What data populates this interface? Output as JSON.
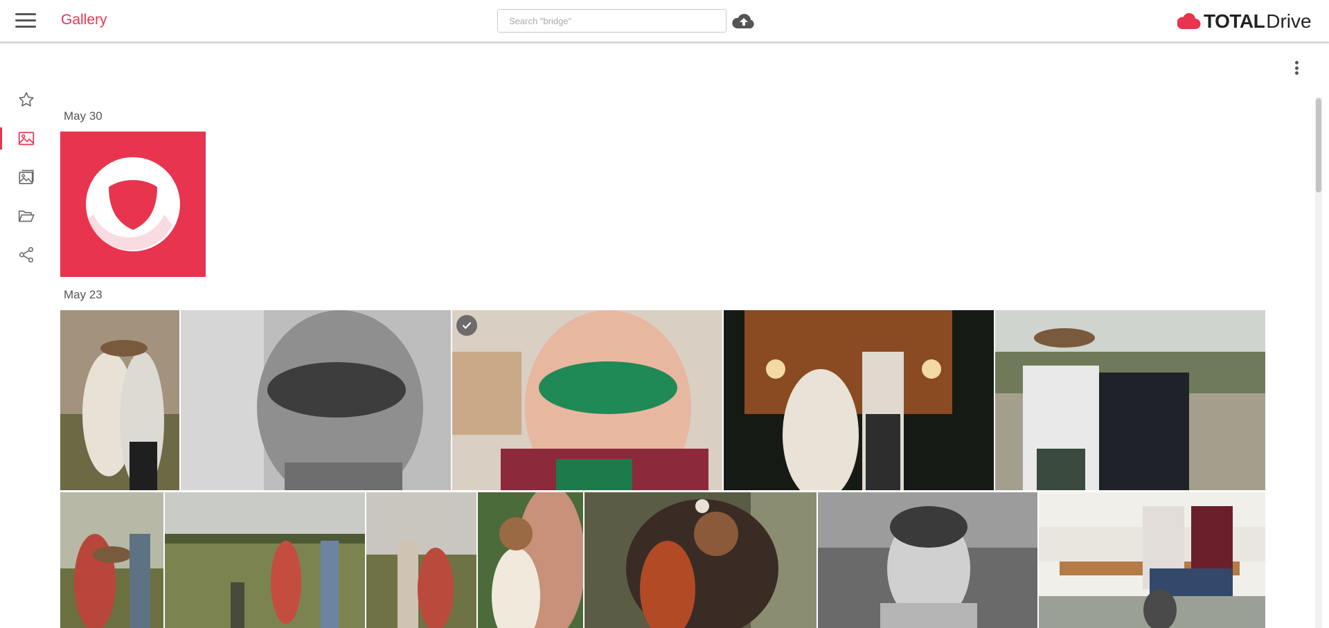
{
  "header": {
    "menu_icon": "hamburger-icon",
    "title": "Gallery",
    "search_placeholder": "Search \"bridge\"",
    "upload_icon": "cloud-upload-icon",
    "brand_bold": "TOTAL",
    "brand_light": "Drive",
    "brand_color": "#e8344e"
  },
  "sidebar": {
    "items": [
      {
        "icon": "star-icon",
        "active": false
      },
      {
        "icon": "image-icon",
        "active": true
      },
      {
        "icon": "photo-album-icon",
        "active": false
      },
      {
        "icon": "folder-open-icon",
        "active": false
      },
      {
        "icon": "share-icon",
        "active": false
      }
    ]
  },
  "toolbar": {
    "more_icon": "more-vertical-icon"
  },
  "groups": [
    {
      "date": "May 30",
      "photo_count": 1
    },
    {
      "date": "May 23",
      "photo_count": 12
    }
  ],
  "selected_photo_icon": "checkmark-circle-icon",
  "accent_color": "#e8344e"
}
